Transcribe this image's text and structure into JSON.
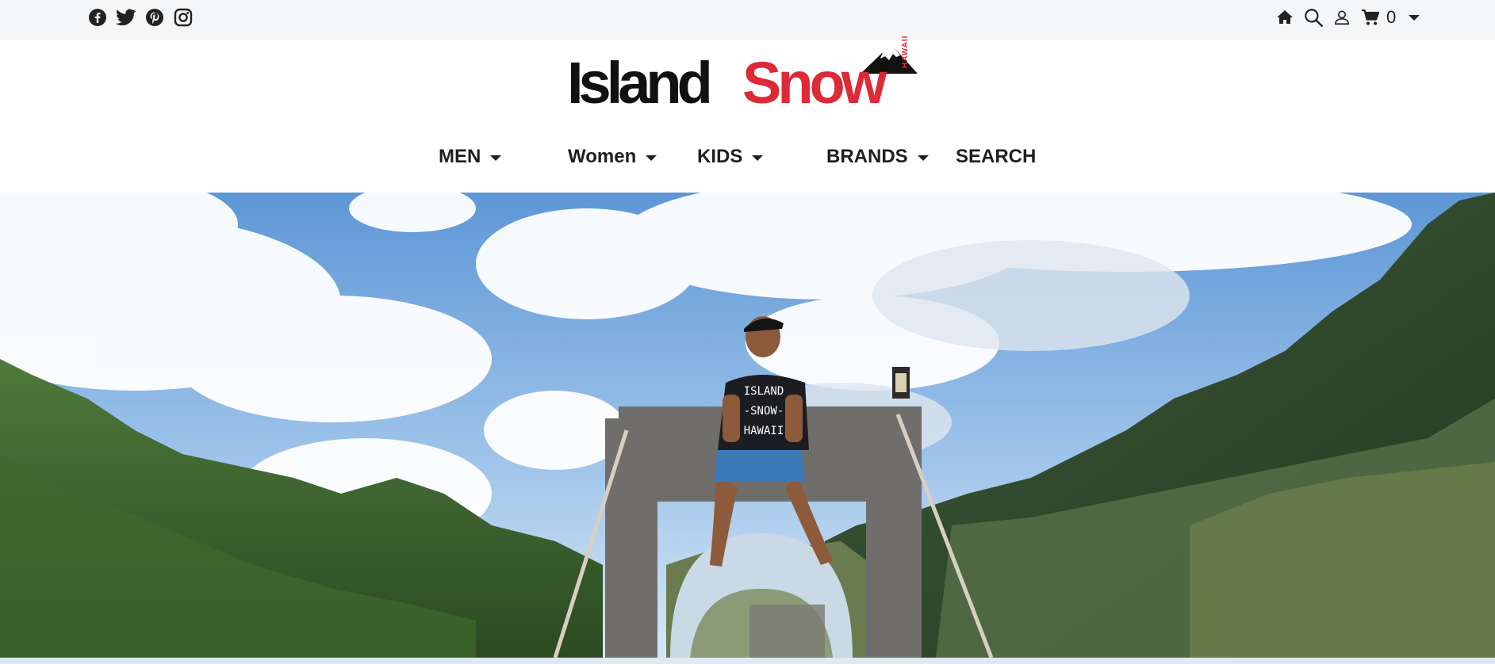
{
  "social": {
    "icons": [
      "facebook-icon",
      "twitter-icon",
      "pinterest-icon",
      "instagram-icon"
    ]
  },
  "utility": {
    "icons": [
      "home-icon",
      "search-icon",
      "user-icon",
      "cart-icon",
      "chevron-down-icon"
    ],
    "cart_count": "0"
  },
  "logo": {
    "word1": "Island",
    "word2": "Snow",
    "tag": "HAWAII"
  },
  "nav": {
    "items": [
      {
        "label": "MEN",
        "dropdown": true
      },
      {
        "label": "Women",
        "dropdown": true
      },
      {
        "label": "KIDS",
        "dropdown": true
      },
      {
        "label": "BRANDS",
        "dropdown": true
      },
      {
        "label": "SEARCH",
        "dropdown": false
      }
    ]
  },
  "hero": {
    "shirt_text": [
      "ISLAND",
      "-SNOW-",
      "HAWAII"
    ]
  },
  "colors": {
    "brand_red": "#dc2a36",
    "topbar_bg": "#f5f6f8",
    "text_dark": "#1f1f1f"
  }
}
